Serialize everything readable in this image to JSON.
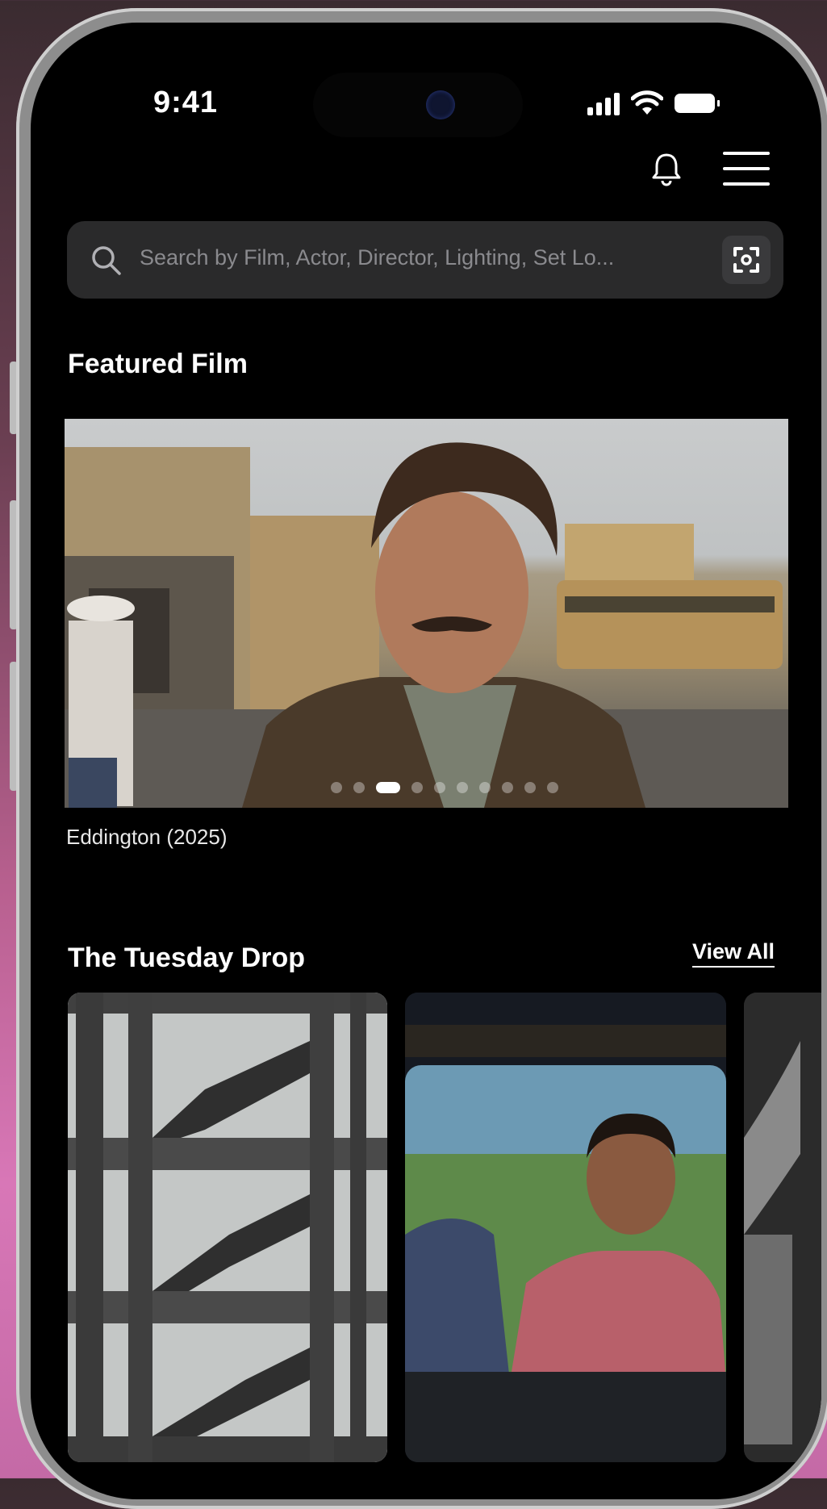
{
  "status_bar": {
    "time": "9:41"
  },
  "search": {
    "placeholder": "Search by Film, Actor, Director, Lighting, Set Lo..."
  },
  "featured": {
    "title": "Featured Film",
    "film_caption": "Eddington (2025)",
    "carousel": {
      "total": 10,
      "active": 3
    }
  },
  "tuesday_drop": {
    "title": "The Tuesday Drop",
    "view_all_label": "View All"
  }
}
